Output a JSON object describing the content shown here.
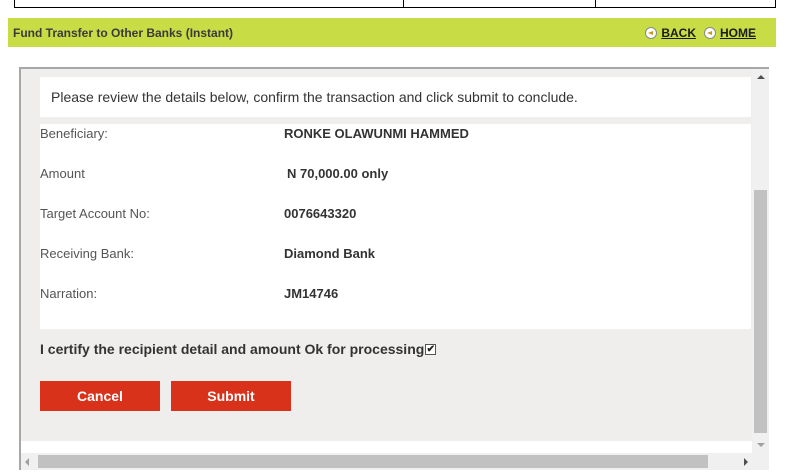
{
  "header": {
    "title": "Fund Transfer to Other Banks (Instant)",
    "back_label": "BACK",
    "home_label": "HOME"
  },
  "notice": "Please review the details below, confirm the transaction and click submit to conclude.",
  "details": [
    {
      "label": "Beneficiary:",
      "value": "RONKE OLAWUNMI HAMMED"
    },
    {
      "label": "Amount",
      "value": "N 70,000.00 only"
    },
    {
      "label": "Target Account No:",
      "value": "0076643320"
    },
    {
      "label": "Receiving Bank:",
      "value": "Diamond Bank"
    },
    {
      "label": "Narration:",
      "value": "JM14746"
    }
  ],
  "certify": {
    "label": "I certify the recipient detail and amount Ok for processing",
    "checked": true
  },
  "buttons": {
    "cancel_label": "Cancel",
    "submit_label": "Submit"
  },
  "colors": {
    "header_bg": "#c8dd45",
    "button_bg": "#d9321b"
  }
}
